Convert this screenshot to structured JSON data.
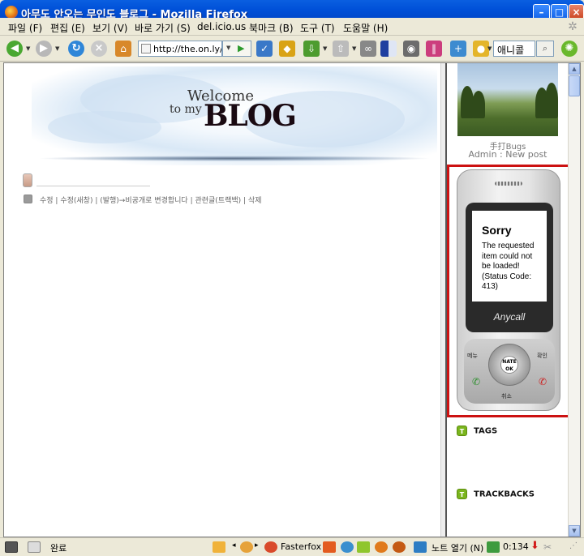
{
  "window": {
    "title": "아무도 안오는 무인도 블로그 - Mozilla Firefox",
    "controls": [
      "minimize",
      "maximize",
      "close"
    ]
  },
  "menubar": {
    "items": [
      "파일 (F)",
      "편집 (E)",
      "보기 (V)",
      "바로 가기 (S)",
      "del.icio.us",
      "북마크 (B)",
      "도구 (T)",
      "도움말 (H)"
    ]
  },
  "navbar": {
    "url": "http://the.on.ly/",
    "search_value": "애니콜"
  },
  "blog": {
    "banner": {
      "welcome": "Welcome",
      "to_my": "to my",
      "blog": "BLOG"
    },
    "post_actions": "수정 | 수정(새창) | (발행)→비공개로 변경합니다 | 관련글(트랙백) | 삭제"
  },
  "sidebar": {
    "username": "手打Bugs",
    "admin_text": "Admin : New post",
    "phone": {
      "sorry": "Sorry",
      "message": "The requested item could not be loaded! (Status Code: 413)",
      "brand": "Anycall",
      "key_menu": "메뉴",
      "key_ok_top": "NATE",
      "key_ok_bottom": "OK",
      "key_confirm": "확인",
      "key_cancel": "취소"
    },
    "tags_title": "TAGS",
    "trackbacks_title": "TRACKBACKS"
  },
  "statusbar": {
    "status": "완료",
    "fasterfox": "Fasterfox",
    "note": "노트 열기 (N)",
    "time": "0:134"
  },
  "colors": {
    "titlebar": "#0050d8",
    "chrome": "#ece9d8",
    "phone_frame": "#cc1111",
    "widget_icon": "#7ab51d"
  }
}
